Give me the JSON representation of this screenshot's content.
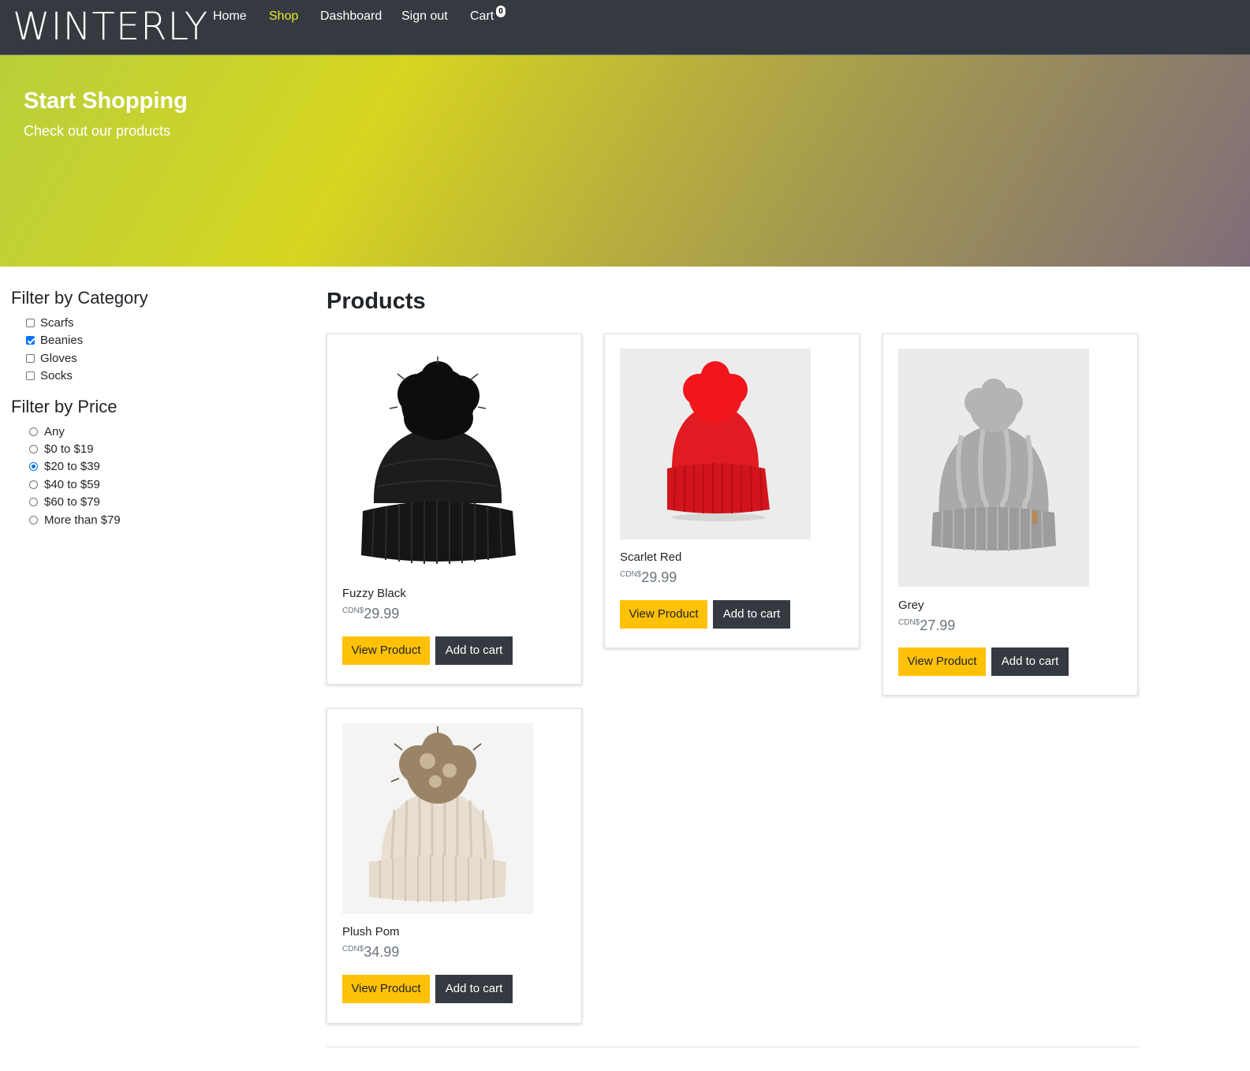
{
  "nav": {
    "brand": "WINTERLY",
    "links": [
      "Home",
      "Shop",
      "Dashboard",
      "Sign out",
      "Cart"
    ],
    "active": "Shop",
    "cart_count": "0"
  },
  "hero": {
    "title": "Start Shopping",
    "subtitle": "Check out our products"
  },
  "filters": {
    "category_heading": "Filter by Category",
    "categories": [
      {
        "label": "Scarfs",
        "checked": false
      },
      {
        "label": "Beanies",
        "checked": true
      },
      {
        "label": "Gloves",
        "checked": false
      },
      {
        "label": "Socks",
        "checked": false
      }
    ],
    "price_heading": "Filter by Price",
    "prices": [
      {
        "label": "Any",
        "selected": false
      },
      {
        "label": "$0 to $19",
        "selected": false
      },
      {
        "label": "$20 to $39",
        "selected": true
      },
      {
        "label": "$40 to $59",
        "selected": false
      },
      {
        "label": "$60 to $79",
        "selected": false
      },
      {
        "label": "More than $79",
        "selected": false
      }
    ]
  },
  "products": {
    "heading": "Products",
    "currency": "CDN$",
    "view_label": "View Product",
    "cart_label": "Add to cart",
    "items": [
      {
        "name": "Fuzzy Black",
        "price": "29.99",
        "image": "black-beanie"
      },
      {
        "name": "Scarlet Red",
        "price": "29.99",
        "image": "red-beanie"
      },
      {
        "name": "Grey",
        "price": "27.99",
        "image": "grey-beanie"
      },
      {
        "name": "Plush Pom",
        "price": "34.99",
        "image": "cream-beanie"
      }
    ]
  },
  "colors": {
    "navbar": "#343a40",
    "active_link": "#e8e82a",
    "view_button": "#ffc107",
    "cart_button": "#343a40"
  }
}
